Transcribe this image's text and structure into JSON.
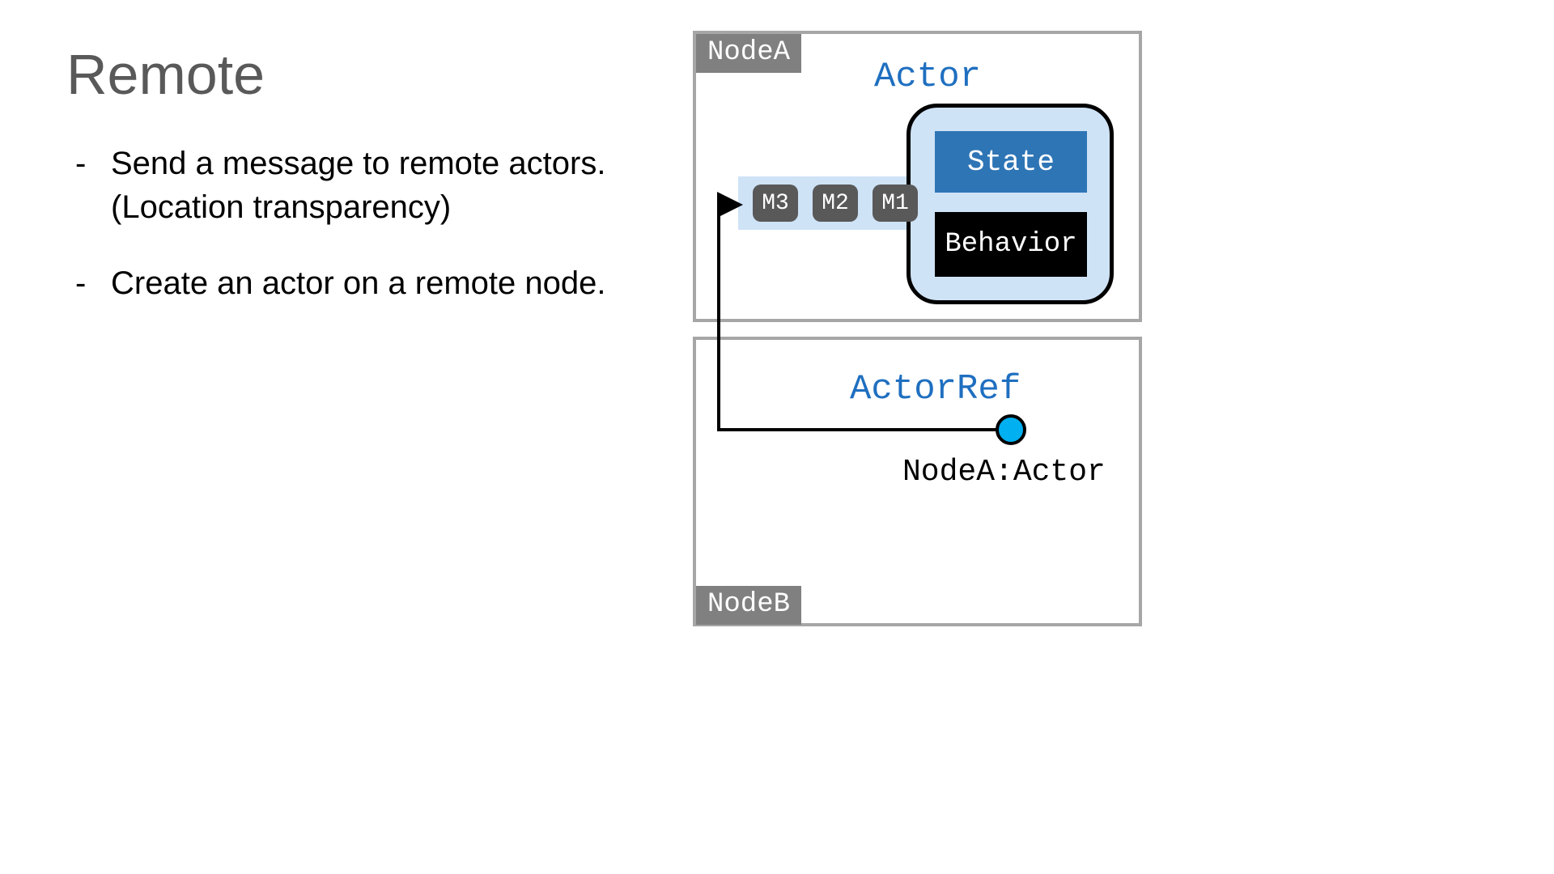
{
  "title": "Remote",
  "bullets": [
    "Send a message to remote actors. (Location transparency)",
    "Create an actor on a remote node."
  ],
  "nodeA": {
    "label": "NodeA",
    "actor_title": "Actor",
    "state_label": "State",
    "behavior_label": "Behavior",
    "messages": [
      "M3",
      "M2",
      "M1"
    ]
  },
  "nodeB": {
    "label": "NodeB",
    "actorref_title": "ActorRef",
    "actorref_path": "NodeA:Actor"
  },
  "colors": {
    "title_gray": "#595959",
    "node_border": "#a6a6a6",
    "node_label_bg": "#808080",
    "accent_blue_text": "#1f6fc0",
    "actor_bg": "#cfe3f7",
    "state_bg": "#2e75b6",
    "behavior_bg": "#000000",
    "msg_bg": "#595959",
    "ref_dot": "#00b0f0"
  }
}
